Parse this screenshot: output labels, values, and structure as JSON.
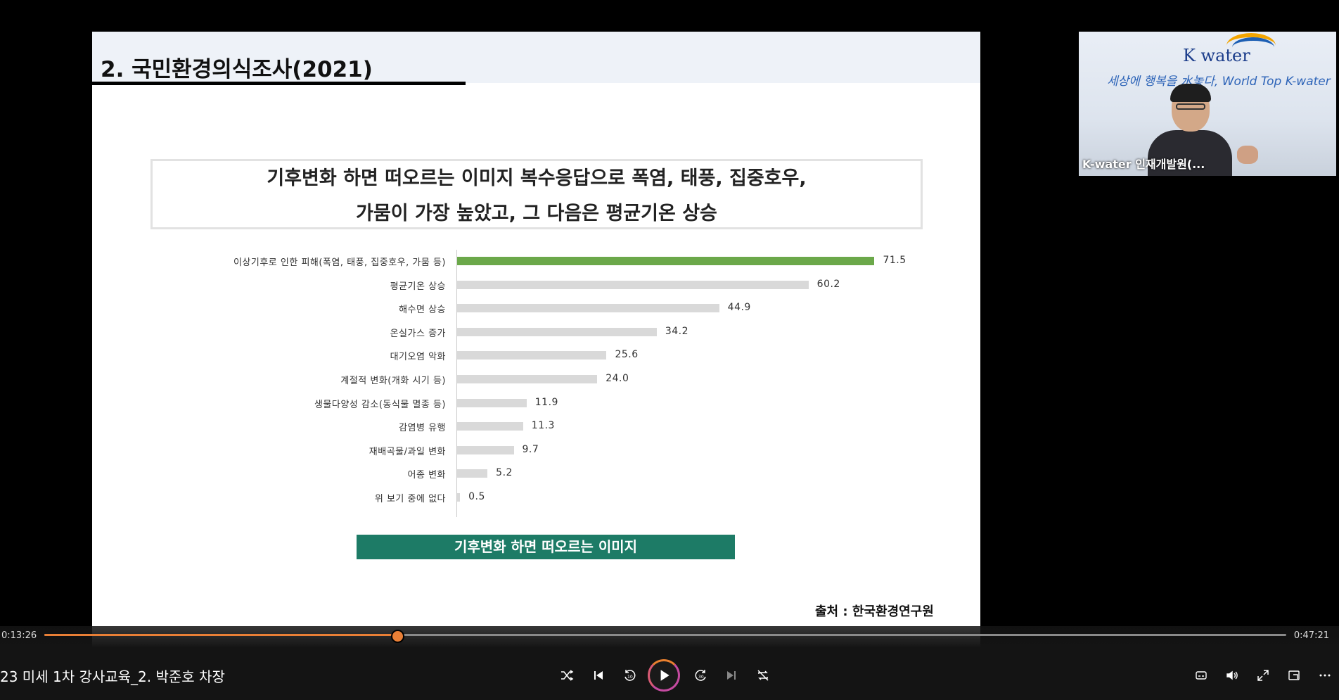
{
  "slide": {
    "title": "2. 국민환경의식조사(2021)",
    "summary_line1": "기후변화 하면 떠오르는 이미지 복수응답으로 폭염, 태풍, 집중호우,",
    "summary_line2": "가뭄이 가장 높았고, 그 다음은 평균기온 상승",
    "caption": "기후변화 하면 떠오르는 이미지",
    "source": "출처 : 한국환경연구원"
  },
  "chart_data": {
    "type": "bar",
    "orientation": "horizontal",
    "title": "기후변화 하면 떠오르는 이미지",
    "categories": [
      "이상기후로 인한 피해(폭염, 태풍, 집중호우, 가뭄 등)",
      "평균기온 상승",
      "해수면 상승",
      "온실가스 증가",
      "대기오염 악화",
      "계절적 변화(개화 시기 등)",
      "생물다양성 감소(동식물 멸종 등)",
      "감염병 유행",
      "재배곡물/과일 변화",
      "어종 변화",
      "위 보기 중에 없다"
    ],
    "values": [
      71.5,
      60.2,
      44.9,
      34.2,
      25.6,
      24.0,
      11.9,
      11.3,
      9.7,
      5.2,
      0.5
    ],
    "value_labels": [
      "71.5",
      "60.2",
      "44.9",
      "34.2",
      "25.6",
      "24.0",
      "11.9",
      "11.3",
      "9.7",
      "5.2",
      "0.5"
    ],
    "highlight_color": "#6ba84a",
    "bar_color": "#d9d9d9",
    "grid": false
  },
  "webcam": {
    "logo": "K water",
    "slogan": "세상에 행복을 水놓다, World Top K-water",
    "name": "K-water 인재개발원(..."
  },
  "player": {
    "current_time": "0:13:26",
    "total_time": "0:47:21",
    "progress": 0.284,
    "video_title": "23 미세 1차 강사교육_2. 박준호 차장",
    "accent_color": "#e97f36"
  }
}
